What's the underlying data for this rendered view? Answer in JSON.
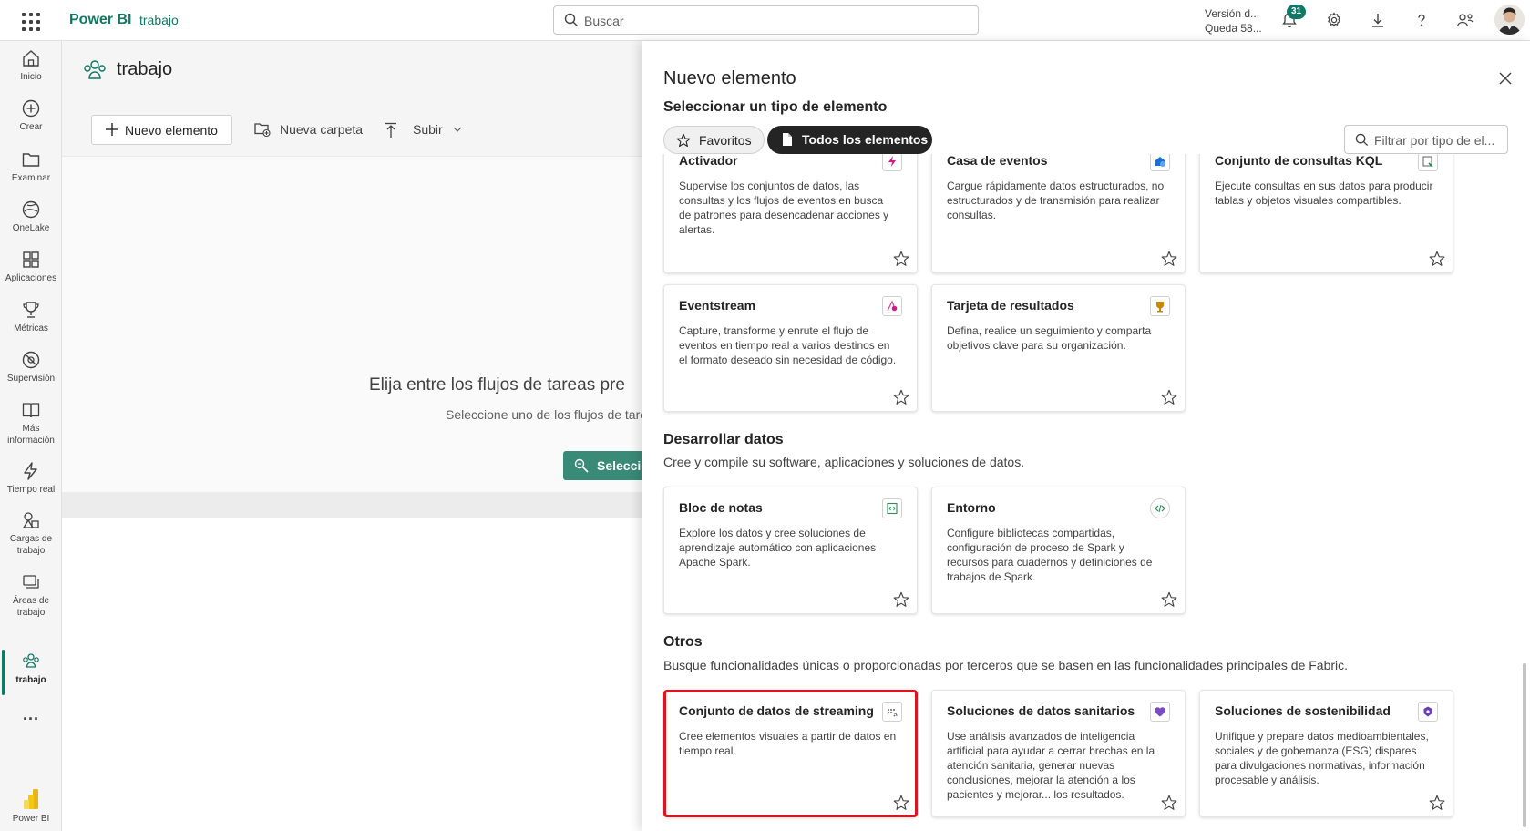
{
  "topbar": {
    "brand": "Power BI",
    "crumb": "trabajo",
    "search_placeholder": "Buscar",
    "trial_line1": "Versión d...",
    "trial_line2": "Queda 58...",
    "notification_count": "31"
  },
  "nav": {
    "items": [
      {
        "label": "Inicio",
        "icon": "home-icon"
      },
      {
        "label": "Crear",
        "icon": "create-icon"
      },
      {
        "label": "Examinar",
        "icon": "folder-icon"
      },
      {
        "label": "OneLake",
        "icon": "onelake-icon"
      },
      {
        "label": "Aplicaciones",
        "icon": "apps-icon"
      },
      {
        "label": "Métricas",
        "icon": "trophy-icon"
      },
      {
        "label": "Supervisión",
        "icon": "monitor-icon"
      },
      {
        "label_line1": "Más",
        "label_line2": "información",
        "icon": "book-icon"
      },
      {
        "label": "Tiempo real",
        "icon": "lightning-icon"
      },
      {
        "label_line1": "Cargas de",
        "label_line2": "trabajo",
        "icon": "workloads-icon"
      },
      {
        "label_line1": "Áreas de",
        "label_line2": "trabajo",
        "icon": "workspaces-icon"
      },
      {
        "label": "trabajo",
        "icon": "people-icon"
      },
      {
        "label": "...",
        "icon": "more-icon"
      },
      {
        "label": "Power BI",
        "icon": "powerbi-icon"
      }
    ]
  },
  "workspace": {
    "title": "trabajo",
    "new_item": "Nuevo elemento",
    "new_folder": "Nueva carpeta",
    "upload": "Subir",
    "heading": "Elija entre los flujos de tareas pre",
    "subheading": "Seleccione uno de los flujos de tare",
    "cta": "Seleccio"
  },
  "panel": {
    "title": "Nuevo elemento",
    "subtitle": "Seleccionar un tipo de elemento",
    "tab_favorites": "Favoritos",
    "tab_all": "Todos los elementos",
    "filter_placeholder": "Filtrar por tipo de el...",
    "row1": [
      {
        "title": "Activador",
        "desc": "Supervise los conjuntos de datos, las consultas y los flujos de eventos en busca de patrones para desencadenar acciones y alertas.",
        "icon": "activator-icon"
      },
      {
        "title": "Casa de eventos",
        "desc": "Cargue rápidamente datos estructurados, no estructurados y de transmisión para realizar consultas.",
        "icon": "eventhouse-icon"
      },
      {
        "title": "Conjunto de consultas KQL",
        "desc": "Ejecute consultas en sus datos para producir tablas y objetos visuales compartibles.",
        "icon": "kql-queryset-icon"
      }
    ],
    "row2": [
      {
        "title": "Eventstream",
        "desc": "Capture, transforme y enrute el flujo de eventos en tiempo real a varios destinos en el formato deseado sin necesidad de código.",
        "icon": "eventstream-icon"
      },
      {
        "title": "Tarjeta de resultados",
        "desc": "Defina, realice un seguimiento y comparta objetivos clave para su organización.",
        "icon": "scorecard-icon"
      }
    ],
    "develop": {
      "title": "Desarrollar datos",
      "desc": "Cree y compile su software, aplicaciones y soluciones de datos.",
      "cards": [
        {
          "title": "Bloc de notas",
          "desc": "Explore los datos y cree soluciones de aprendizaje automático con aplicaciones Apache Spark.",
          "icon": "notebook-icon"
        },
        {
          "title": "Entorno",
          "desc": "Configure bibliotecas compartidas, configuración de proceso de Spark y recursos para cuadernos y definiciones de trabajos de Spark.",
          "icon": "environment-icon"
        }
      ]
    },
    "others": {
      "title": "Otros",
      "desc": "Busque funcionalidades únicas o proporcionadas por terceros que se basen en las funcionalidades principales de Fabric.",
      "cards": [
        {
          "title": "Conjunto de datos de streaming",
          "desc": "Cree elementos visuales a partir de datos en tiempo real.",
          "icon": "streaming-dataset-icon"
        },
        {
          "title": "Soluciones de datos sanitarios",
          "desc": "Use análisis avanzados de inteligencia artificial para ayudar a cerrar brechas en la atención sanitaria, generar nuevas conclusiones, mejorar la atención a los pacientes y mejorar... los resultados.",
          "icon": "healthcare-icon"
        },
        {
          "title": "Soluciones de sostenibilidad",
          "desc": "Unifique y prepare datos medioambientales, sociales y de gobernanza (ESG) dispares para divulgaciones normativas, información procesable y análisis.",
          "icon": "sustainability-icon"
        }
      ]
    }
  }
}
